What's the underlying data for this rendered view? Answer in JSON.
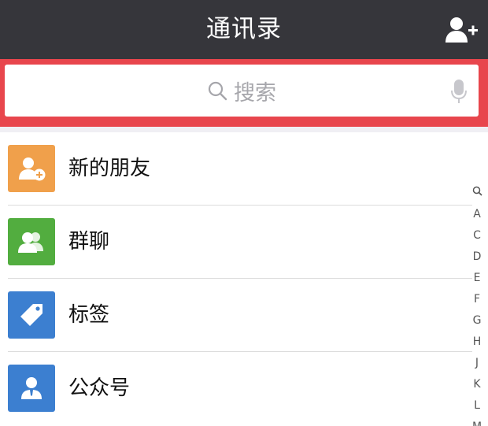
{
  "navbar": {
    "title": "通讯录",
    "add_contact_icon": "add-contact-icon"
  },
  "search": {
    "placeholder": "搜索",
    "search_icon": "search-icon",
    "mic_icon": "mic-icon",
    "highlight_color": "#e8464d"
  },
  "list": {
    "items": [
      {
        "label": "新的朋友",
        "icon": "new-friend-icon",
        "color": "#f0a04b"
      },
      {
        "label": "群聊",
        "icon": "group-chat-icon",
        "color": "#52ad3f"
      },
      {
        "label": "标签",
        "icon": "tag-icon",
        "color": "#3c7fd0"
      },
      {
        "label": "公众号",
        "icon": "official-account-icon",
        "color": "#3c7fd0"
      }
    ]
  },
  "index_bar": {
    "letters": [
      "Q",
      "A",
      "C",
      "D",
      "E",
      "F",
      "G",
      "H",
      "J",
      "K",
      "L",
      "M"
    ]
  }
}
